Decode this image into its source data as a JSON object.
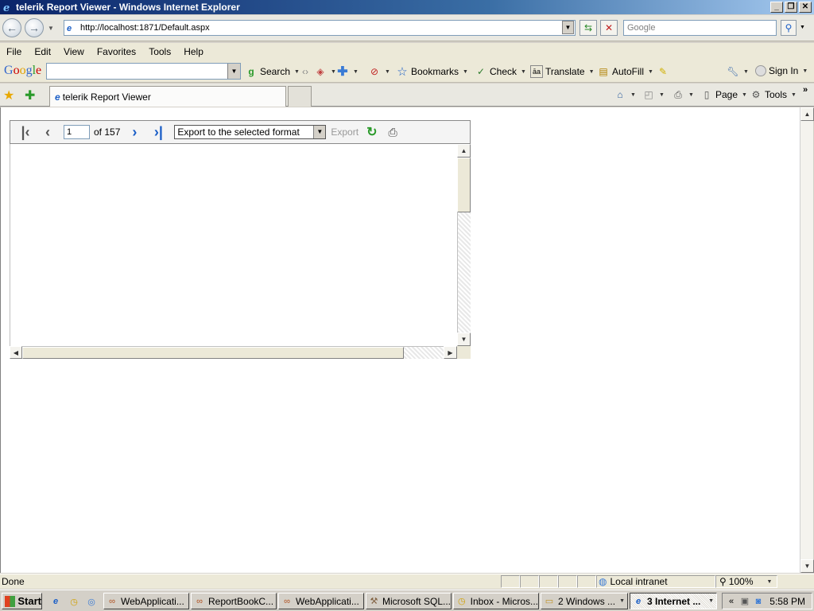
{
  "window": {
    "title": "telerik Report Viewer - Windows Internet Explorer",
    "icon": "ie-icon"
  },
  "address": {
    "url": "http://localhost:1871/Default.aspx",
    "search_placeholder": "Google"
  },
  "menu": [
    "File",
    "Edit",
    "View",
    "Favorites",
    "Tools",
    "Help"
  ],
  "google_toolbar": {
    "logo": "Google",
    "search_label": "Search",
    "bookmarks_label": "Bookmarks",
    "check_label": "Check",
    "translate_label": "Translate",
    "autofill_label": "AutoFill",
    "signin_label": "Sign In"
  },
  "tabs": {
    "active_title": "telerik Report Viewer",
    "page_label": "Page",
    "tools_label": "Tools"
  },
  "report_viewer": {
    "page_value": "1",
    "page_of": "of 157",
    "export_format": "Export to the selected format",
    "export_label": "Export"
  },
  "statusbar": {
    "status": "Done",
    "zone": "Local intranet",
    "zoom": "100%"
  },
  "taskbar": {
    "start": "Start",
    "buttons": [
      "WebApplicati...",
      "ReportBookC...",
      "WebApplicati...",
      "Microsoft SQL...",
      "Inbox - Micros...",
      "2 Windows ...",
      "3 Internet ..."
    ],
    "clock": "5:58 PM"
  }
}
